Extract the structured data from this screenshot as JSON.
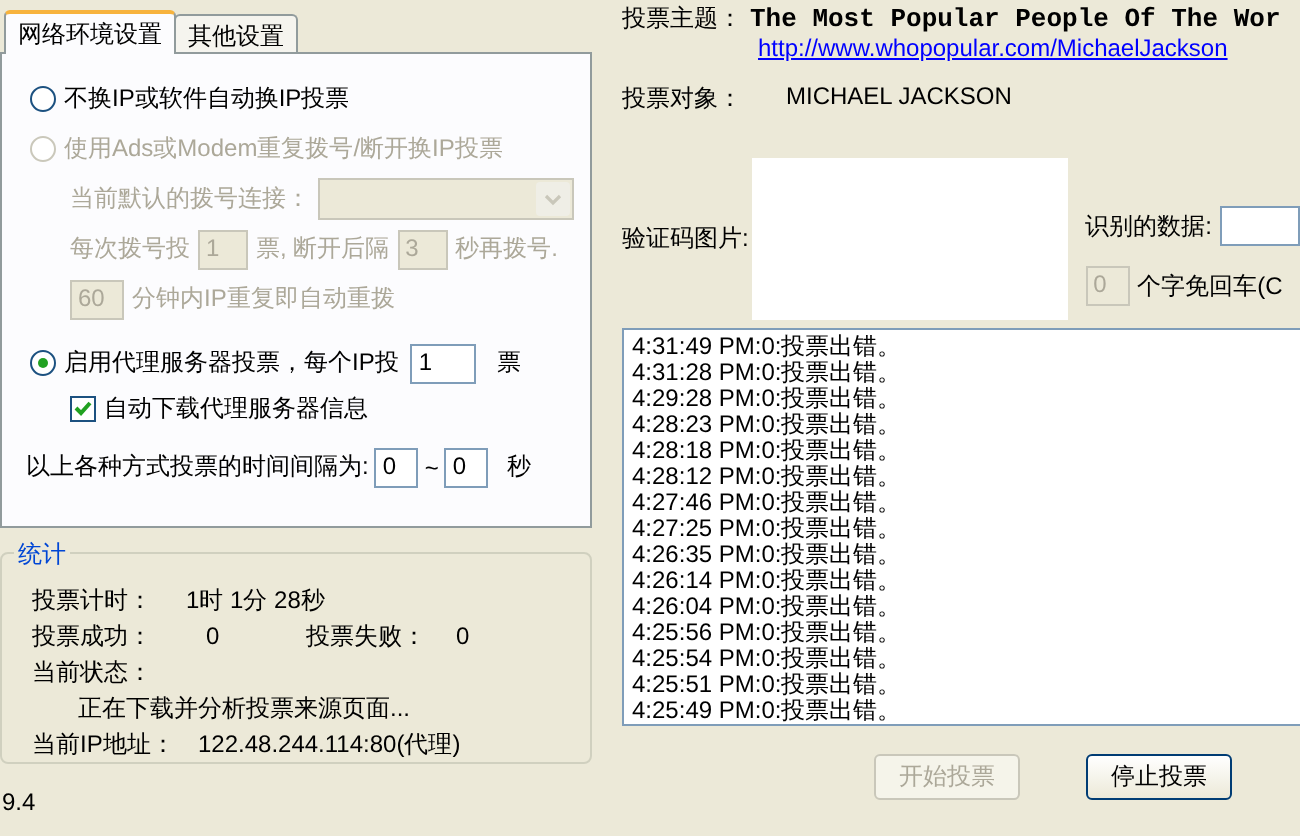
{
  "tabs": [
    {
      "label": "网络环境设置",
      "selected": true
    },
    {
      "label": "其他设置",
      "selected": false
    }
  ],
  "no_change_option": {
    "label": "不换IP或软件自动换IP投票",
    "selected": false
  },
  "dialup_option": {
    "label": "使用Ads或Modem重复拨号/断开换IP投票",
    "selected": false,
    "disabled": true,
    "connection_label": "当前默认的拨号连接：",
    "votes_before": "每次拨号投",
    "votes_value": "1",
    "votes_after": "票, 断开后隔",
    "wait_value": "3",
    "wait_after": "秒再拨号.",
    "repeat_value": "60",
    "repeat_label": "分钟内IP重复即自动重拨"
  },
  "proxy_option": {
    "label": "启用代理服务器投票，每个IP投",
    "selected": true,
    "votes_value": "1",
    "votes_unit": "票",
    "auto_download": {
      "label": "自动下载代理服务器信息",
      "checked": true
    }
  },
  "interval": {
    "label": "以上各种方式投票的时间间隔为:",
    "min": "0",
    "separator": "~",
    "max": "0",
    "unit": "秒"
  },
  "stats": {
    "title": "统计",
    "timer_label": "投票计时：",
    "timer": "1时 1分 28秒",
    "success_label": "投票成功：",
    "success": "0",
    "fail_label": "投票失败：",
    "fail": "0",
    "status_label": "当前状态：",
    "status": "正在下载并分析投票来源页面...",
    "ip_label": "当前IP地址：",
    "ip": "122.48.244.114:80(代理)"
  },
  "version": "9.4",
  "topic_label": "投票主题：",
  "topic": "The Most Popular People Of The Wor",
  "link": "http://www.whopopular.com/MichaelJackson",
  "target_label": "投票对象：",
  "target": "MICHAEL JACKSON",
  "captcha_label": "验证码图片:",
  "recognized_label": "识别的数据:",
  "auto_count": "0",
  "auto_label": "个字免回车(C",
  "log": [
    "4:31:49 PM:0:投票出错。",
    "4:31:28 PM:0:投票出错。",
    "4:29:28 PM:0:投票出错。",
    "4:28:23 PM:0:投票出错。",
    "4:28:18 PM:0:投票出错。",
    "4:28:12 PM:0:投票出错。",
    "4:27:46 PM:0:投票出错。",
    "4:27:25 PM:0:投票出错。",
    "4:26:35 PM:0:投票出错。",
    "4:26:14 PM:0:投票出错。",
    "4:26:04 PM:0:投票出错。",
    "4:25:56 PM:0:投票出错。",
    "4:25:54 PM:0:投票出错。",
    "4:25:51 PM:0:投票出错。",
    "4:25:49 PM:0:投票出错。"
  ],
  "buttons": [
    {
      "label": "开始投票",
      "disabled": true
    },
    {
      "label": "停止投票",
      "disabled": false
    }
  ]
}
